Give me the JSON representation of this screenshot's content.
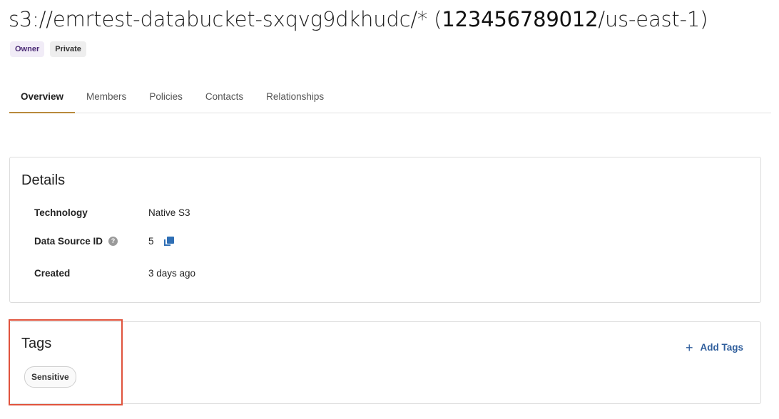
{
  "header": {
    "title_prefix": "s3://emrtest-databucket-sxqvg9dkhudc/* (",
    "title_account": "123456789012",
    "title_suffix": "/us-east-1)",
    "badges": [
      "Owner",
      "Private"
    ]
  },
  "tabs": [
    {
      "label": "Overview",
      "active": true
    },
    {
      "label": "Members"
    },
    {
      "label": "Policies"
    },
    {
      "label": "Contacts"
    },
    {
      "label": "Relationships"
    }
  ],
  "details": {
    "title": "Details",
    "technology_label": "Technology",
    "technology_value": "Native S3",
    "data_source_id_label": "Data Source ID",
    "data_source_id_value": "5",
    "created_label": "Created",
    "created_value": "3 days ago",
    "help_icon": "?"
  },
  "tags": {
    "title": "Tags",
    "items": [
      "Sensitive"
    ],
    "add_label": "Add Tags",
    "add_icon": "+"
  },
  "colors": {
    "accent_tab": "#b88a3c",
    "link": "#2f5e9c",
    "highlight": "#e0533d"
  }
}
